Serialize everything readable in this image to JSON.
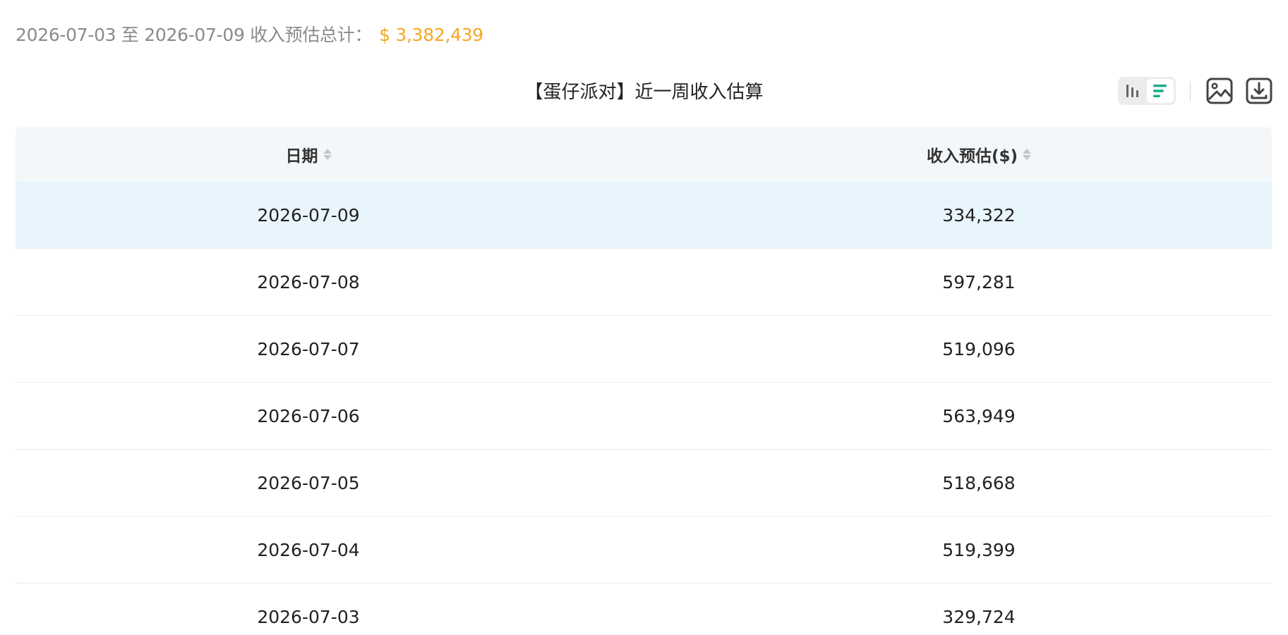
{
  "summary": {
    "range_text": "2026-07-03 至 2026-07-09 收入预估总计：",
    "total": "$ 3,382,439"
  },
  "table_title": "【蛋仔派对】近一周收入估算",
  "toolbar": {
    "chart_view_icon": "bar-chart-icon",
    "table_view_icon": "table-list-icon",
    "save_image_icon": "image-icon",
    "download_icon": "download-icon",
    "accent_color": "#1aaa8a"
  },
  "columns": {
    "date": "日期",
    "revenue": "收入预估($)"
  },
  "rows": [
    {
      "date": "2026-07-09",
      "revenue": "334,322"
    },
    {
      "date": "2026-07-08",
      "revenue": "597,281"
    },
    {
      "date": "2026-07-07",
      "revenue": "519,096"
    },
    {
      "date": "2026-07-06",
      "revenue": "563,949"
    },
    {
      "date": "2026-07-05",
      "revenue": "518,668"
    },
    {
      "date": "2026-07-04",
      "revenue": "519,399"
    },
    {
      "date": "2026-07-03",
      "revenue": "329,724"
    }
  ]
}
